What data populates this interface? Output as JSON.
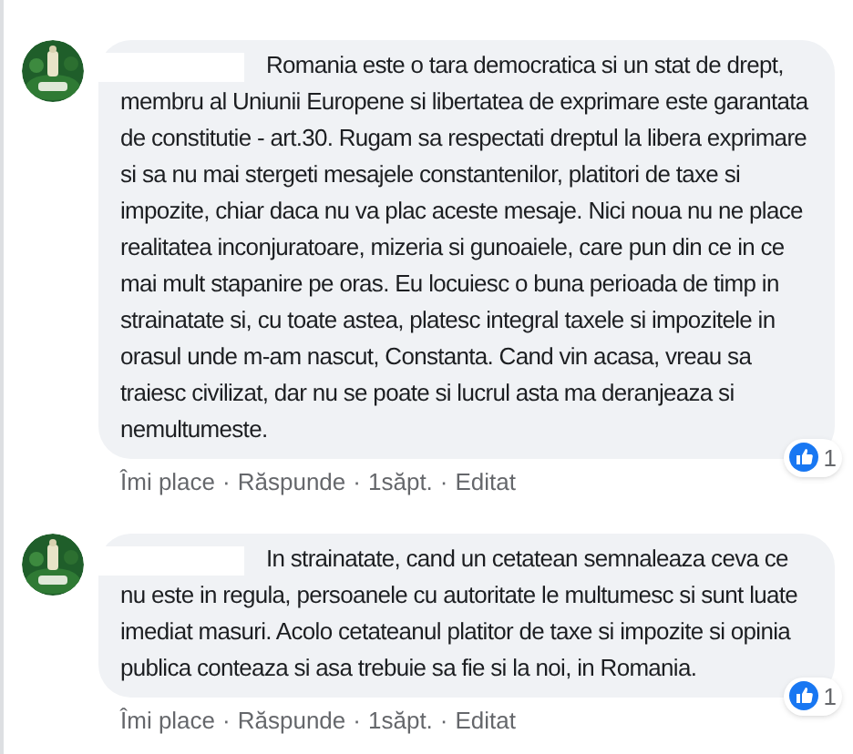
{
  "separator": "·",
  "comments": [
    {
      "text": "Romania este o tara democratica si un stat de drept, membru al Uniunii Europene si libertatea de exprimare este garantata de constitutie - art.30. Rugam sa respectati dreptul la libera exprimare si sa nu mai stergeti mesajele constantenilor, platitori de taxe si impozite, chiar daca nu va plac aceste mesaje. Nici noua nu ne place realitatea inconjuratoare, mizeria si gunoaiele, care pun din ce in ce mai mult stapanire pe oras. Eu locuiesc o buna perioada de timp in strainatate si, cu toate astea, platesc integral taxele si impozitele in orasul unde m-am nascut, Constanta. Cand vin acasa, vreau sa traiesc civilizat, dar nu se poate si lucrul asta ma deranjeaza si nemultumeste.",
      "reactions": "1",
      "actions": [
        "Îmi place",
        "Răspunde",
        "1săpt.",
        "Editat"
      ]
    },
    {
      "text": "In strainatate, cand un cetatean semnaleaza ceva ce nu este in regula, persoanele cu autoritate le multumesc si sunt luate imediat masuri. Acolo cetateanul platitor de taxe si impozite si opinia publica conteaza si asa trebuie sa fie si la noi, in Romania.",
      "reactions": "1",
      "actions": [
        "Îmi place",
        "Răspunde",
        "1săpt.",
        "Editat"
      ]
    }
  ]
}
